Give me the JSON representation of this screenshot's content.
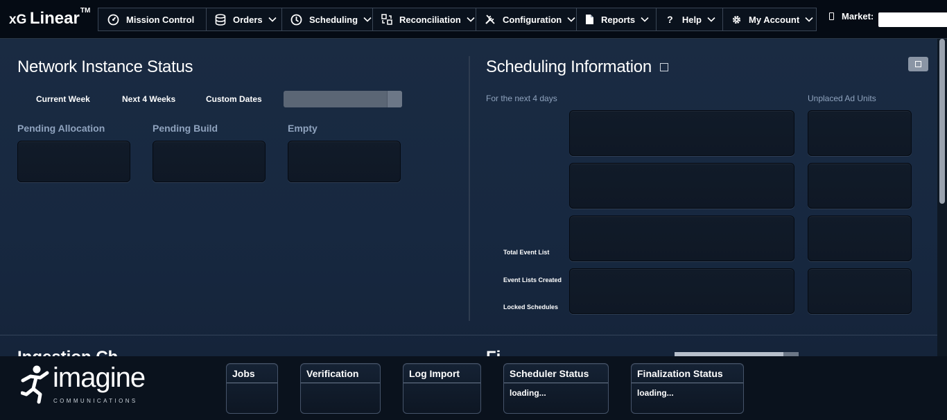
{
  "app": {
    "logo_prefix": "xG",
    "logo_name": "Linear",
    "logo_mark": "TM"
  },
  "nav": [
    {
      "label": "Mission Control",
      "icon": "dashboard-icon",
      "dropdown": false
    },
    {
      "label": "Orders",
      "icon": "database-icon",
      "dropdown": true
    },
    {
      "label": "Scheduling",
      "icon": "clock-icon",
      "dropdown": true
    },
    {
      "label": "Reconciliation",
      "icon": "reconcile-icon",
      "dropdown": true
    },
    {
      "label": "Configuration",
      "icon": "tools-icon",
      "dropdown": true
    },
    {
      "label": "Reports",
      "icon": "document-icon",
      "dropdown": true
    },
    {
      "label": "Help",
      "icon": "question-icon",
      "dropdown": true
    },
    {
      "label": "My Account",
      "icon": "gear-icon",
      "dropdown": true
    }
  ],
  "market": {
    "label": "Market:",
    "value": ""
  },
  "network_status": {
    "title": "Network Instance Status",
    "tabs": [
      "Current Week",
      "Next 4 Weeks",
      "Custom Dates"
    ],
    "columns": [
      "Pending Allocation",
      "Pending Build",
      "Empty"
    ]
  },
  "scheduling": {
    "title": "Scheduling Information",
    "subtitle": "For the next 4 days",
    "unplaced_label": "Unplaced Ad Units",
    "row_labels": [
      "Total Event List",
      "Event Lists Created",
      "Locked Schedules"
    ]
  },
  "lower_partial": {
    "left": "Ingestion Ch",
    "right": "Fi"
  },
  "footer": {
    "brand": "imagine",
    "brand_sub": "COMMUNICATIONS",
    "cards": [
      {
        "title": "Jobs",
        "status": ""
      },
      {
        "title": "Verification",
        "status": ""
      },
      {
        "title": "Log Import",
        "status": ""
      },
      {
        "title": "Scheduler Status",
        "status": "loading..."
      },
      {
        "title": "Finalization Status",
        "status": "loading..."
      }
    ]
  },
  "colors": {
    "background": "#16243a",
    "topbar": "#050b14",
    "label_blue": "#8fa3be",
    "panel": "#111b29"
  }
}
